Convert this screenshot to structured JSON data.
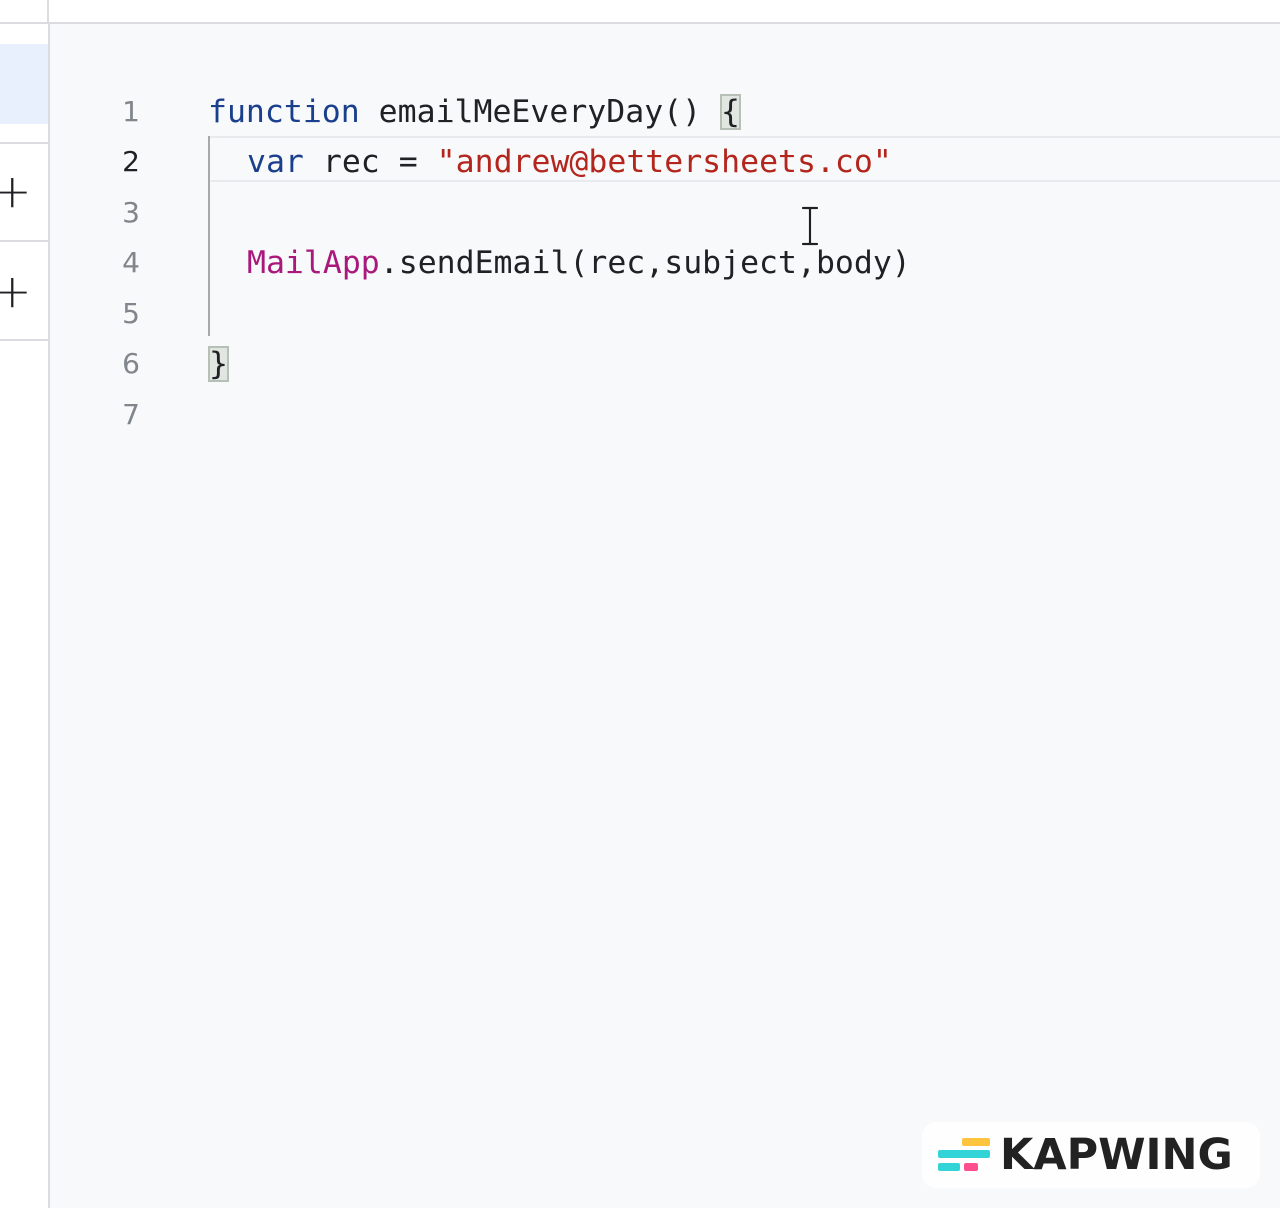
{
  "editor": {
    "lines": [
      {
        "number": "1",
        "tokens": {
          "t1": "function",
          "t2": " emailMeEveryDay() ",
          "t3": "{"
        }
      },
      {
        "number": "2",
        "tokens": {
          "t1": "var",
          "t2": " rec = ",
          "t3": "\"andrew@bettersheets.co\""
        }
      },
      {
        "number": "3"
      },
      {
        "number": "4",
        "tokens": {
          "t1": "MailApp",
          "t2": ".sendEmail(rec,subject,body)"
        }
      },
      {
        "number": "5"
      },
      {
        "number": "6",
        "tokens": {
          "t1": "}"
        }
      },
      {
        "number": "7"
      }
    ],
    "active_line": "2",
    "colors": {
      "keyword": "#1a3f8c",
      "string": "#b3261e",
      "class": "#a8197b",
      "background": "#f8f9fa"
    }
  },
  "sidebar": {
    "buttons": [
      {
        "icon": "plus-icon",
        "label": "+"
      },
      {
        "icon": "plus-icon",
        "label": "+"
      }
    ]
  },
  "watermark": {
    "text": "KAPWING",
    "icon": "kapwing-logo-icon"
  }
}
